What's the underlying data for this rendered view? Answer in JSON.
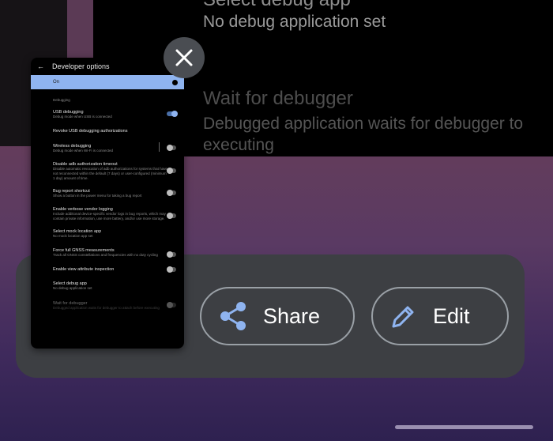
{
  "background": {
    "item1_title": "Select debug app",
    "item1_sub": "No debug application set",
    "item2_title": "Wait for debugger",
    "item2_sub_line1": "Debugged application waits for debugger to",
    "item2_sub_line2": "executing"
  },
  "thumbnail": {
    "title": "Developer options",
    "main_toggle": "On",
    "section": "Debugging",
    "rows": [
      {
        "title": "USB debugging",
        "sub": "Debug mode when USB is connected",
        "toggle": "on"
      },
      {
        "title": "Revoke USB debugging authorizations",
        "sub": "",
        "toggle": "none"
      },
      {
        "title": "Wireless debugging",
        "sub": "Debug mode when Wi-Fi is connected",
        "toggle": "off"
      },
      {
        "title": "Disable adb authorization timeout",
        "sub": "Disable automatic revocation of adb authorizations for systems that have not reconnected within the default (7 days) or user-configured (minimum 1 day) amount of time.",
        "toggle": "off"
      },
      {
        "title": "Bug report shortcut",
        "sub": "Show a button in the power menu for taking a bug report",
        "toggle": "off"
      },
      {
        "title": "Enable verbose vendor logging",
        "sub": "Include additional device-specific vendor logs in bug reports, which may contain private information, use more battery, and/or use more storage.",
        "toggle": "off"
      },
      {
        "title": "Select mock location app",
        "sub": "No mock location app set",
        "toggle": "none"
      },
      {
        "title": "Force full GNSS measurements",
        "sub": "Track all GNSS constellations and frequencies with no duty cycling",
        "toggle": "off"
      },
      {
        "title": "Enable view attribute inspection",
        "sub": "",
        "toggle": "off"
      },
      {
        "title": "Select debug app",
        "sub": "No debug application set",
        "toggle": "none"
      },
      {
        "title": "Wait for debugger",
        "sub": "Debugged application waits for debugger to attach before executing",
        "toggle": "off"
      }
    ]
  },
  "actions": {
    "share_label": "Share",
    "edit_label": "Edit"
  },
  "icons": {
    "close": "close-icon",
    "share": "share-icon",
    "edit": "pencil-icon"
  },
  "colors": {
    "accent": "#8fb4f0"
  }
}
